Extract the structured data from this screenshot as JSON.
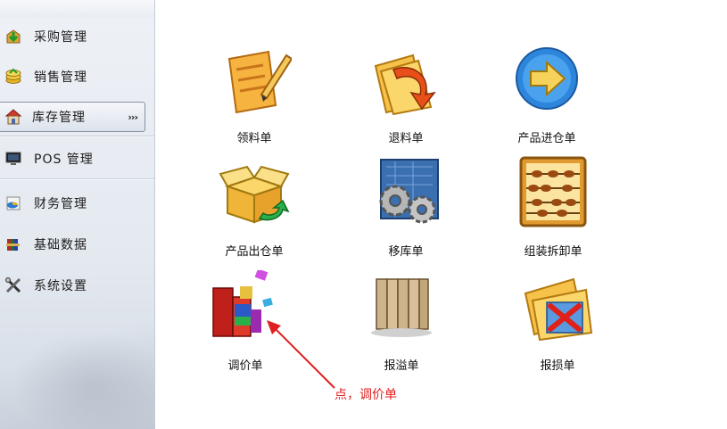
{
  "sidebar": {
    "items": [
      {
        "label": "采购管理",
        "icon": "green-arrow-box-icon"
      },
      {
        "label": "销售管理",
        "icon": "stacked-coins-icon"
      },
      {
        "label": "库存管理",
        "icon": "warehouse-house-icon",
        "active": true,
        "expand": "›››"
      },
      {
        "label": "POS 管理",
        "icon": "monitor-icon"
      },
      {
        "label": "财务管理",
        "icon": "finance-chart-icon"
      },
      {
        "label": "基础数据",
        "icon": "archive-books-icon"
      },
      {
        "label": "系统设置",
        "icon": "tools-icon"
      }
    ]
  },
  "main": {
    "tiles": [
      {
        "label": "领料单",
        "icon": "pencil-notepad-icon"
      },
      {
        "label": "退料单",
        "icon": "return-arrow-folder-icon"
      },
      {
        "label": "产品进仓单",
        "icon": "blue-arrow-circle-icon"
      },
      {
        "label": "产品出仓单",
        "icon": "open-box-recycle-icon"
      },
      {
        "label": "移库单",
        "icon": "gears-blueprint-icon"
      },
      {
        "label": "组装拆卸单",
        "icon": "abacus-icon"
      },
      {
        "label": "调价单",
        "icon": "colored-blocks-icon"
      },
      {
        "label": "报溢单",
        "icon": "file-folders-icon"
      },
      {
        "label": "报损单",
        "icon": "folder-red-x-icon"
      }
    ]
  },
  "annotation": {
    "text": "点，调价单",
    "color": "#e02020"
  }
}
